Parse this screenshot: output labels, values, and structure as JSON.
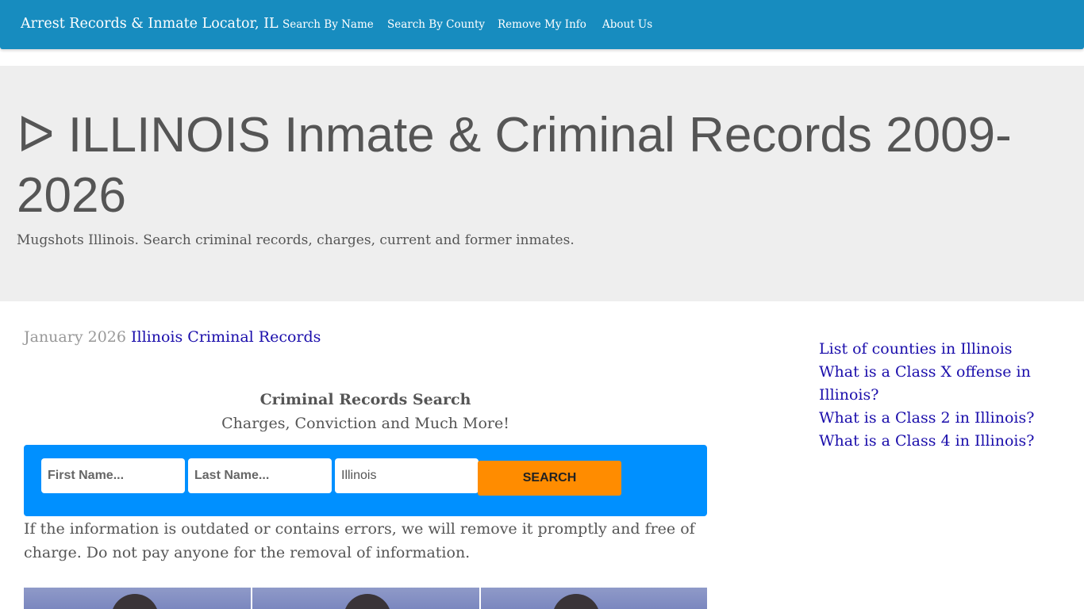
{
  "nav": {
    "brand": "Arrest Records & Inmate Locator, IL",
    "items": [
      {
        "label": "Search By Name"
      },
      {
        "label": "Search By County"
      },
      {
        "label": "Remove My Info"
      },
      {
        "label": "About Us"
      }
    ]
  },
  "hero": {
    "title": "ᐅ ILLINOIS Inmate & Criminal Records 2009-2026",
    "subtitle": "Mugshots Illinois. Search criminal records, charges, current and former inmates."
  },
  "main": {
    "date": "January 2026",
    "date_link": "Illinois Criminal Records",
    "search_title": "Criminal Records Search",
    "search_subtitle": "Charges, Conviction and Much More!",
    "search": {
      "first_name_placeholder": "First Name...",
      "last_name_placeholder": "Last Name...",
      "state_value": "Illinois",
      "button_label": "SEARCH"
    },
    "notice": "If the information is outdated or contains errors, we will remove it promptly and free of charge. Do not pay anyone for the removal of information."
  },
  "sidebar": {
    "links": [
      {
        "label": "List of counties in Illinois"
      },
      {
        "label": "What is a Class X offense in Illinois?"
      },
      {
        "label": "What is a Class 2 in Illinois?"
      },
      {
        "label": "What is a Class 4 in Illinois?"
      }
    ]
  },
  "colors": {
    "nav_bg": "#178cbf",
    "hero_bg": "#eeeeee",
    "search_box_bg": "#0090ff",
    "search_button_bg": "#ff8c00",
    "link": "#1a0dab"
  }
}
